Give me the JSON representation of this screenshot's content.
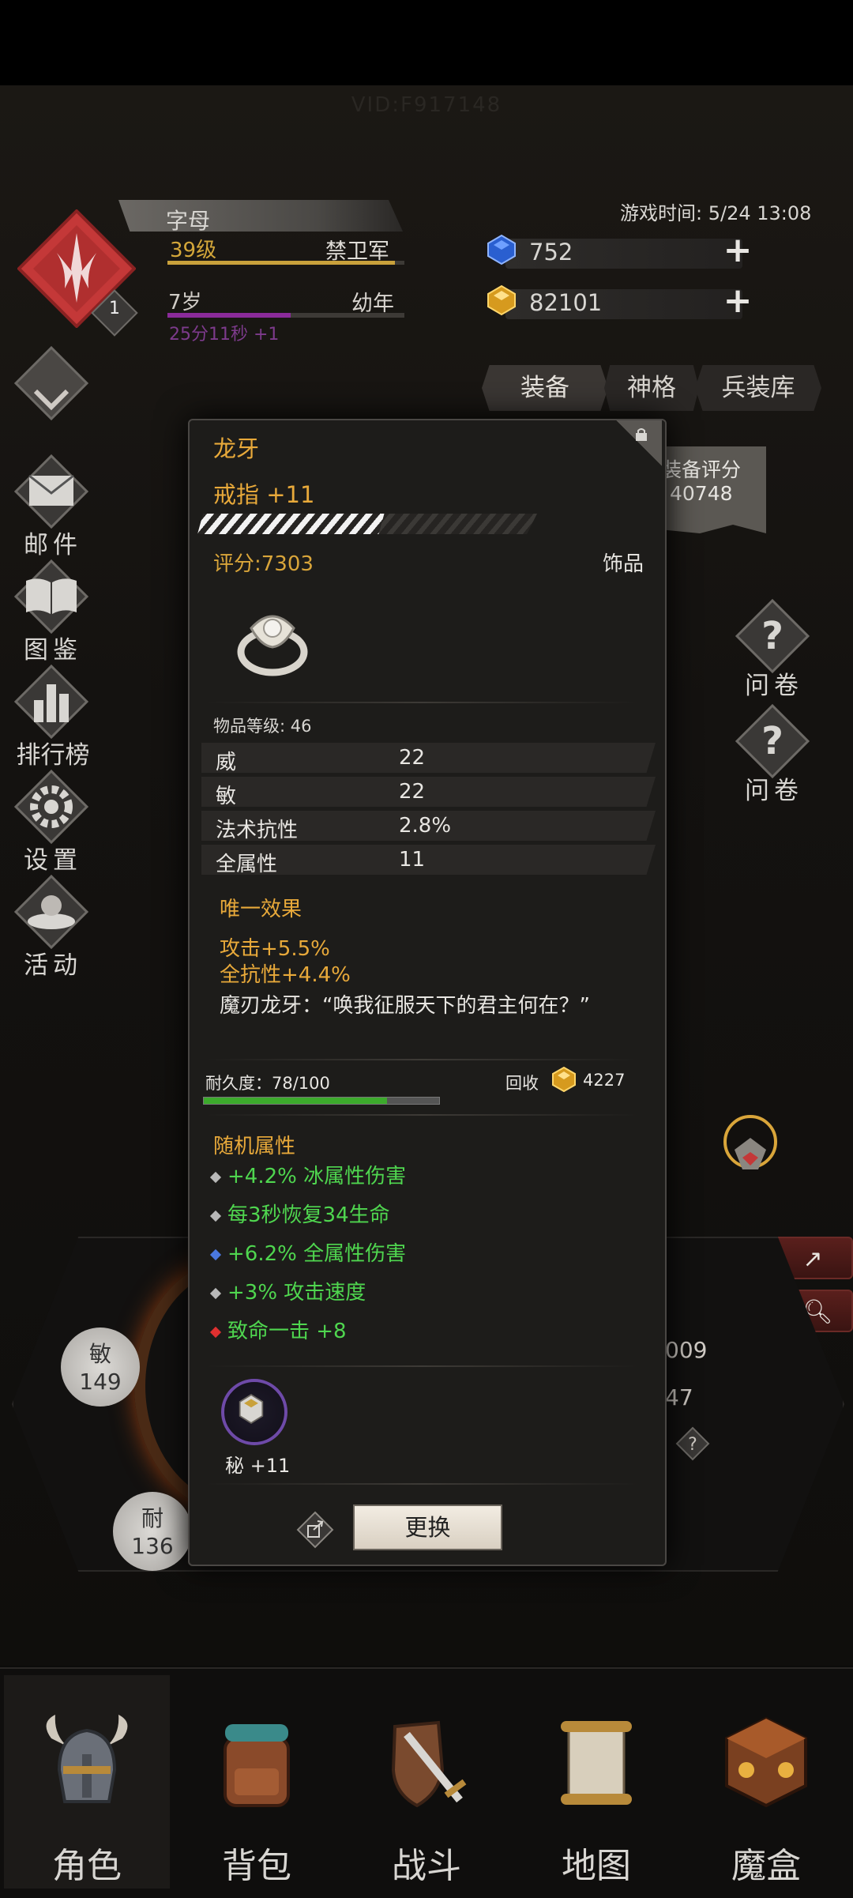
{
  "watermark": "VID:F917148",
  "player": {
    "name": "字母",
    "level": "39级",
    "title": "禁卫军",
    "badge_level": "1",
    "age": "7岁",
    "age_stage": "幼年",
    "age_timer": "25分11秒 +1",
    "exp_progress": 0.96,
    "age_progress": 0.52
  },
  "game_time": "游戏时间: 5/24 13:08",
  "currency": {
    "gems": "752",
    "gold": "82101"
  },
  "tabs": [
    "装备",
    "神格",
    "兵装库"
  ],
  "equip_score": {
    "label": "装备评分",
    "value": "40748"
  },
  "left_menu": [
    "邮件",
    "图鉴",
    "排行榜",
    "设置",
    "活动"
  ],
  "right_menu": {
    "survey_1": "问卷",
    "survey_2": "问卷",
    "stats_button": "统计",
    "details_button": "详情"
  },
  "background_stats": {
    "agility_label": "敏",
    "agility": "149",
    "endurance_label": "耐",
    "endurance": "136",
    "value_a": "009",
    "value_b": "47"
  },
  "item": {
    "name": "龙牙",
    "type": "戒指 +11",
    "enhance_progress": 0.55,
    "score": "评分:7303",
    "category": "饰品",
    "item_level": "物品等级: 46",
    "attributes": [
      {
        "name": "威",
        "value": "22"
      },
      {
        "name": "敏",
        "value": "22"
      },
      {
        "name": "法术抗性",
        "value": "2.8%"
      },
      {
        "name": "全属性",
        "value": "11"
      }
    ],
    "unique_title": "唯一效果",
    "unique_effects": [
      "攻击+5.5%",
      "全抗性+4.4%"
    ],
    "flavor": "魔刃龙牙：“唤我征服天下的君主何在？”",
    "durability": "耐久度：78/100",
    "durability_progress": 0.78,
    "recycle_label": "回收",
    "recycle_value": "4227",
    "random_title": "随机属性",
    "random_attributes": [
      {
        "text": "+4.2% 冰属性伤害",
        "dot_color": "#b8b8b8"
      },
      {
        "text": "每3秒恢复34生命",
        "dot_color": "#b8b8b8"
      },
      {
        "text": "+6.2% 全属性伤害",
        "dot_color": "#4a78e0"
      },
      {
        "text": "+3% 攻击速度",
        "dot_color": "#b8b8b8"
      },
      {
        "text": "致命一击 +8",
        "dot_color": "#e03030"
      }
    ],
    "gem_slot_label": "秘 +11",
    "replace_button": "更换"
  },
  "bottom_nav": [
    "角色",
    "背包",
    "战斗",
    "地图",
    "魔盒"
  ],
  "colors": {
    "accent_gold": "#e8a93a",
    "random_green": "#4fd64f",
    "exp_bar": "#c9a13b",
    "age_bar": "#8b2b9a",
    "durability_bar": "#3caa2c"
  }
}
